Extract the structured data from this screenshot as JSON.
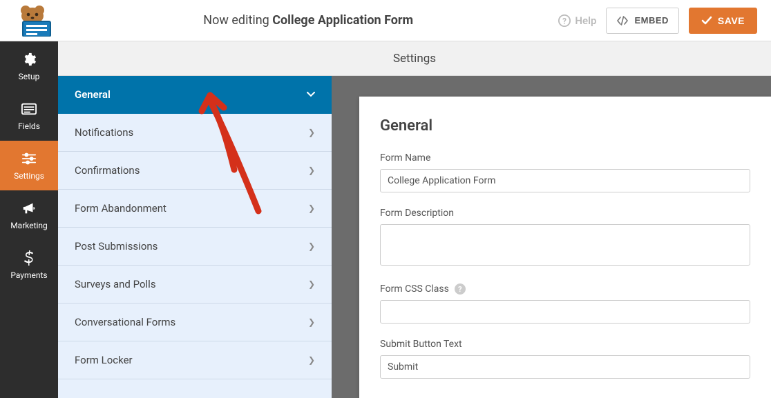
{
  "topbar": {
    "editing_prefix": "Now editing ",
    "form_title": "College Application Form",
    "help_label": "Help",
    "embed_label": "EMBED",
    "save_label": "SAVE"
  },
  "leftnav": {
    "items": [
      {
        "label": "Setup",
        "icon": "gear-icon",
        "active": false
      },
      {
        "label": "Fields",
        "icon": "list-icon",
        "active": false
      },
      {
        "label": "Settings",
        "icon": "sliders-icon",
        "active": true
      },
      {
        "label": "Marketing",
        "icon": "bullhorn-icon",
        "active": false
      },
      {
        "label": "Payments",
        "icon": "dollar-icon",
        "active": false
      }
    ]
  },
  "subheader": "Settings",
  "settings_menu": {
    "items": [
      {
        "label": "General",
        "active": true,
        "expandable": true
      },
      {
        "label": "Notifications",
        "active": false
      },
      {
        "label": "Confirmations",
        "active": false
      },
      {
        "label": "Form Abandonment",
        "active": false
      },
      {
        "label": "Post Submissions",
        "active": false
      },
      {
        "label": "Surveys and Polls",
        "active": false
      },
      {
        "label": "Conversational Forms",
        "active": false
      },
      {
        "label": "Form Locker",
        "active": false
      }
    ]
  },
  "general_panel": {
    "heading": "General",
    "fields": {
      "form_name_label": "Form Name",
      "form_name_value": "College Application Form",
      "form_description_label": "Form Description",
      "form_description_value": "",
      "form_css_label": "Form CSS Class",
      "form_css_value": "",
      "submit_text_label": "Submit Button Text",
      "submit_text_value": "Submit"
    }
  },
  "colors": {
    "accent_orange": "#e27730",
    "accent_blue": "#0073aa",
    "panel_blue": "#e7f0fc"
  }
}
